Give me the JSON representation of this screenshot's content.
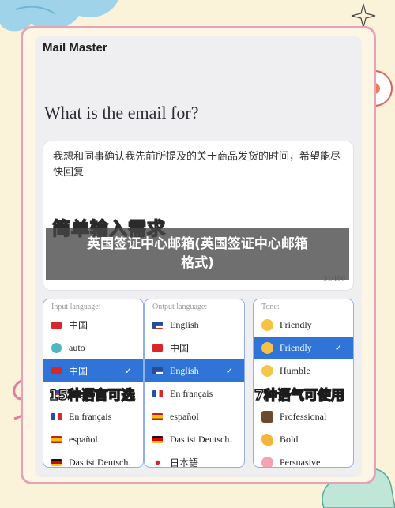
{
  "app": {
    "title": "Mail Master"
  },
  "question": "What is the email for?",
  "input": {
    "text": "我想和同事确认我先前所提及的关于商品发货的时间，希望能尽快回复",
    "counter": "31/100"
  },
  "banner": {
    "subtitle": "简单输入需求",
    "overlay_line1": "英国签证中心邮箱(英国签证中心邮箱",
    "overlay_line2": "格式)"
  },
  "input_language": {
    "label": "Input language:",
    "items": [
      {
        "label": "中国",
        "flag": "cn"
      },
      {
        "label": "auto",
        "flag": "auto"
      },
      {
        "label": "中国",
        "flag": "cn",
        "selected": true
      },
      {
        "label": "English",
        "flag": "us"
      },
      {
        "label": "En français",
        "flag": "fr"
      },
      {
        "label": "español",
        "flag": "es"
      },
      {
        "label": "Das ist Deutsch.",
        "flag": "de"
      }
    ]
  },
  "output_language": {
    "label": "Output language:",
    "items": [
      {
        "label": "English",
        "flag": "us"
      },
      {
        "label": "中国",
        "flag": "cn"
      },
      {
        "label": "English",
        "flag": "us",
        "selected": true
      },
      {
        "label": "En français",
        "flag": "fr"
      },
      {
        "label": "español",
        "flag": "es"
      },
      {
        "label": "Das ist Deutsch.",
        "flag": "de"
      },
      {
        "label": "日本語",
        "flag": "jp"
      }
    ]
  },
  "tone": {
    "label": "Tone:",
    "items": [
      {
        "label": "Friendly",
        "icon": "smile-face"
      },
      {
        "label": "Friendly",
        "icon": "smile-face",
        "selected": true
      },
      {
        "label": "Humble",
        "icon": "relieved-face"
      },
      {
        "label": "",
        "icon": "none"
      },
      {
        "label": "Professional",
        "icon": "briefcase"
      },
      {
        "label": "Bold",
        "icon": "flexed-arm"
      },
      {
        "label": "Persuasive",
        "icon": "brain"
      }
    ]
  },
  "stickers": {
    "languages": "15种语言可选",
    "tones": "7种语气可使用"
  },
  "check_mark": "✓",
  "colors": {
    "accent": "#2f74d6",
    "frame": "#e6a3b8",
    "background": "#fbf3d9"
  }
}
